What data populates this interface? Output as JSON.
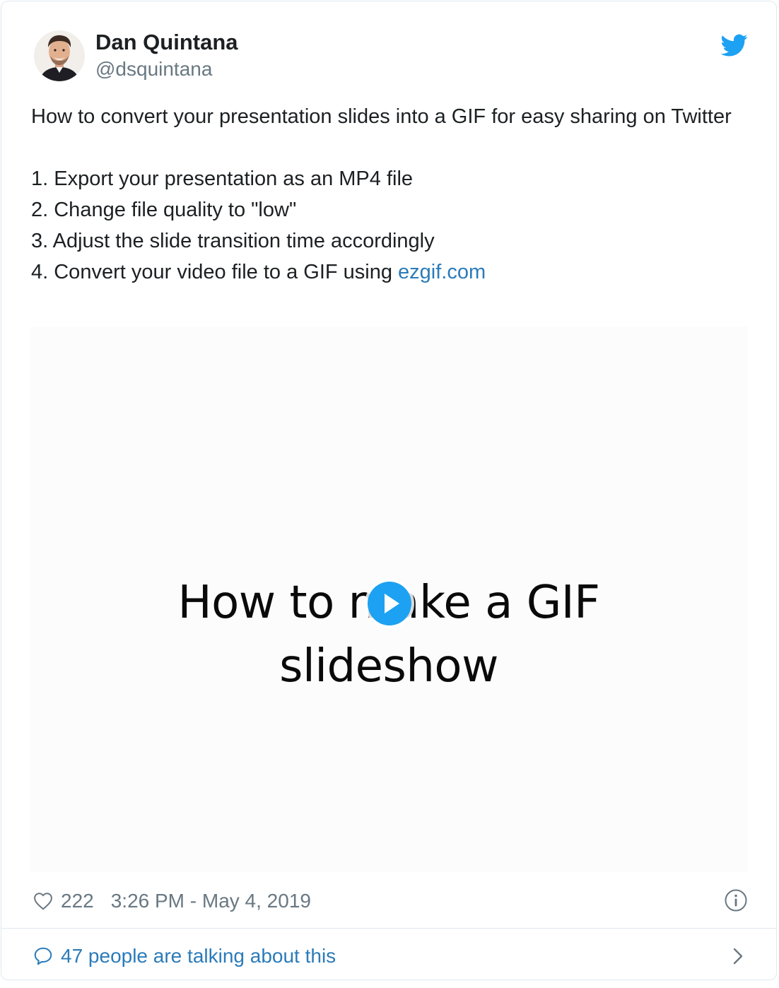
{
  "author": {
    "name": "Dan Quintana",
    "handle": "@dsquintana"
  },
  "tweet": {
    "intro": "How to convert your presentation slides into a GIF for easy sharing on Twitter",
    "steps": [
      "1. Export your presentation as an MP4 file",
      "2. Change file quality to \"low\"",
      "3. Adjust the slide transition time accordingly",
      "4. Convert your video file to a GIF using "
    ],
    "link_text": "ezgif.com"
  },
  "media": {
    "slide_line1": "How to make a GIF",
    "slide_line2": "slideshow",
    "icon": "play-icon"
  },
  "footer": {
    "like_count": "222",
    "timestamp": "3:26 PM - May 4, 2019",
    "conversation": "47 people are talking about this"
  },
  "icons": {
    "brand": "twitter-bird-icon",
    "like": "heart-icon",
    "info": "info-icon",
    "reply": "speech-bubble-icon",
    "more": "chevron-right-icon"
  },
  "colors": {
    "twitter_blue": "#1da1f2",
    "link": "#2b7bb9",
    "muted": "#697882",
    "text": "#1c2022",
    "border": "#e1e8ed"
  }
}
